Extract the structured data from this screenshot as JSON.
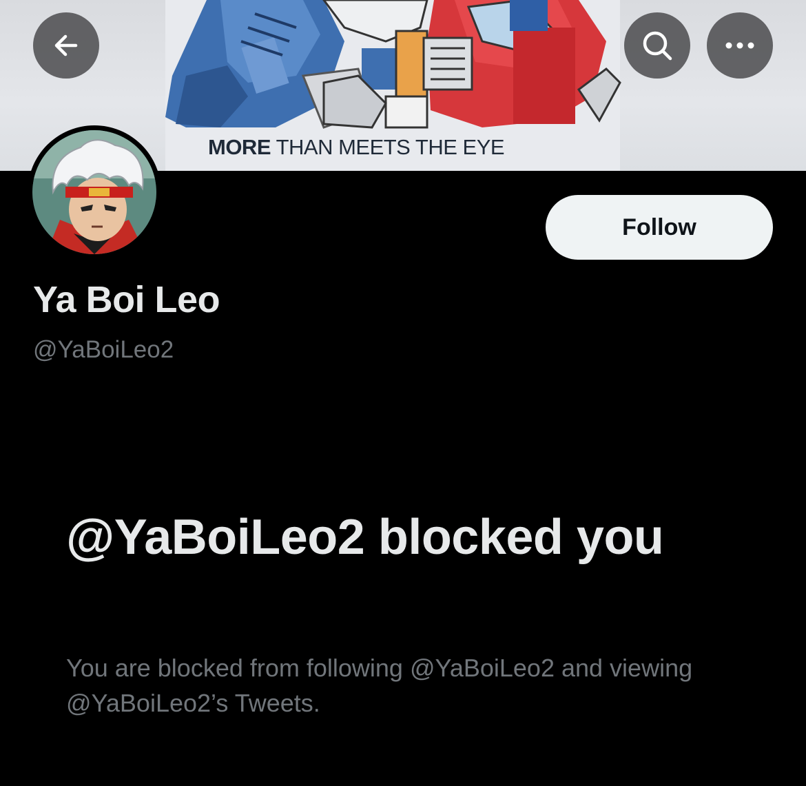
{
  "header": {
    "banner_tagline_bold": "MORE",
    "banner_tagline_rest": "THAN MEETS THE EYE",
    "back_icon": "arrow-left-icon",
    "search_icon": "search-icon",
    "more_icon": "more-horizontal-icon"
  },
  "profile": {
    "display_name": "Ya Boi Leo",
    "handle": "@YaBoiLeo2",
    "follow_label": "Follow"
  },
  "blocked": {
    "title": "@YaBoiLeo2 blocked you",
    "description": "You are blocked from following @YaBoiLeo2 and viewing @YaBoiLeo2’s Tweets."
  },
  "colors": {
    "background": "#000000",
    "primary_text": "#e7e9ea",
    "secondary_text": "#71767b",
    "follow_button_bg": "#eff3f4"
  }
}
